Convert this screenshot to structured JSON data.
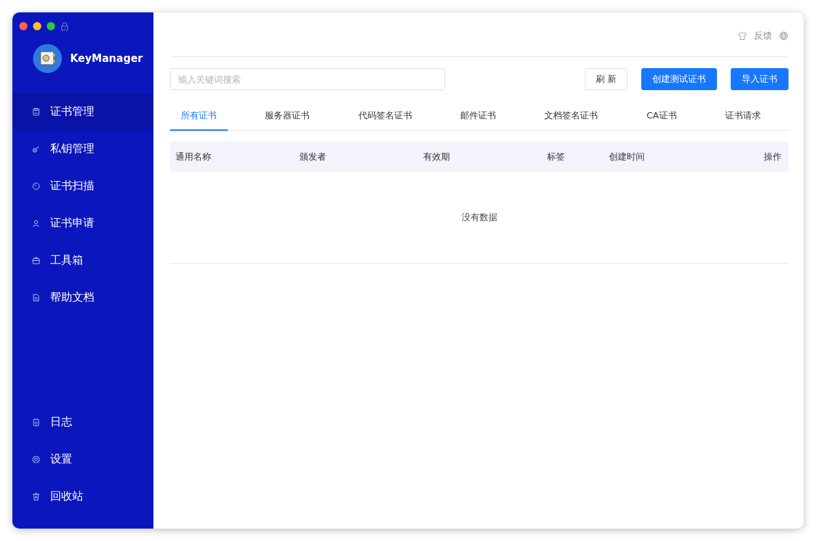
{
  "app": {
    "name": "KeyManager"
  },
  "sidebar": {
    "items": [
      {
        "kind": "save",
        "label": "证书管理",
        "selected": true
      },
      {
        "kind": "key",
        "label": "私钥管理",
        "selected": false
      },
      {
        "kind": "scan",
        "label": "证书扫描",
        "selected": false
      },
      {
        "kind": "user",
        "label": "证书申请",
        "selected": false
      },
      {
        "kind": "box",
        "label": "工具箱",
        "selected": false
      },
      {
        "kind": "doc",
        "label": "帮助文档",
        "selected": false
      }
    ],
    "bottom_items": [
      {
        "kind": "log",
        "label": "日志",
        "selected": false
      },
      {
        "kind": "gear",
        "label": "设置",
        "selected": false
      },
      {
        "kind": "trash",
        "label": "回收站",
        "selected": false
      }
    ]
  },
  "topbar": {
    "feedback": "反馈"
  },
  "search": {
    "placeholder": "输入关键词搜索"
  },
  "buttons": [
    {
      "label": "刷 新",
      "kind": "default"
    },
    {
      "label": "创建测试证书",
      "kind": "primary"
    },
    {
      "label": "导入证书",
      "kind": "primary"
    }
  ],
  "tabs": [
    {
      "label": "所有证书",
      "selected": true
    },
    {
      "label": "服务器证书",
      "selected": false
    },
    {
      "label": "代码签名证书",
      "selected": false
    },
    {
      "label": "邮件证书",
      "selected": false
    },
    {
      "label": "文档签名证书",
      "selected": false
    },
    {
      "label": "CA证书",
      "selected": false
    },
    {
      "label": "证书请求",
      "selected": false
    }
  ],
  "table": {
    "columns": [
      "通用名称",
      "颁发者",
      "有效期",
      "标签",
      "创建时间",
      "操作"
    ],
    "empty_text": "没有数据"
  }
}
